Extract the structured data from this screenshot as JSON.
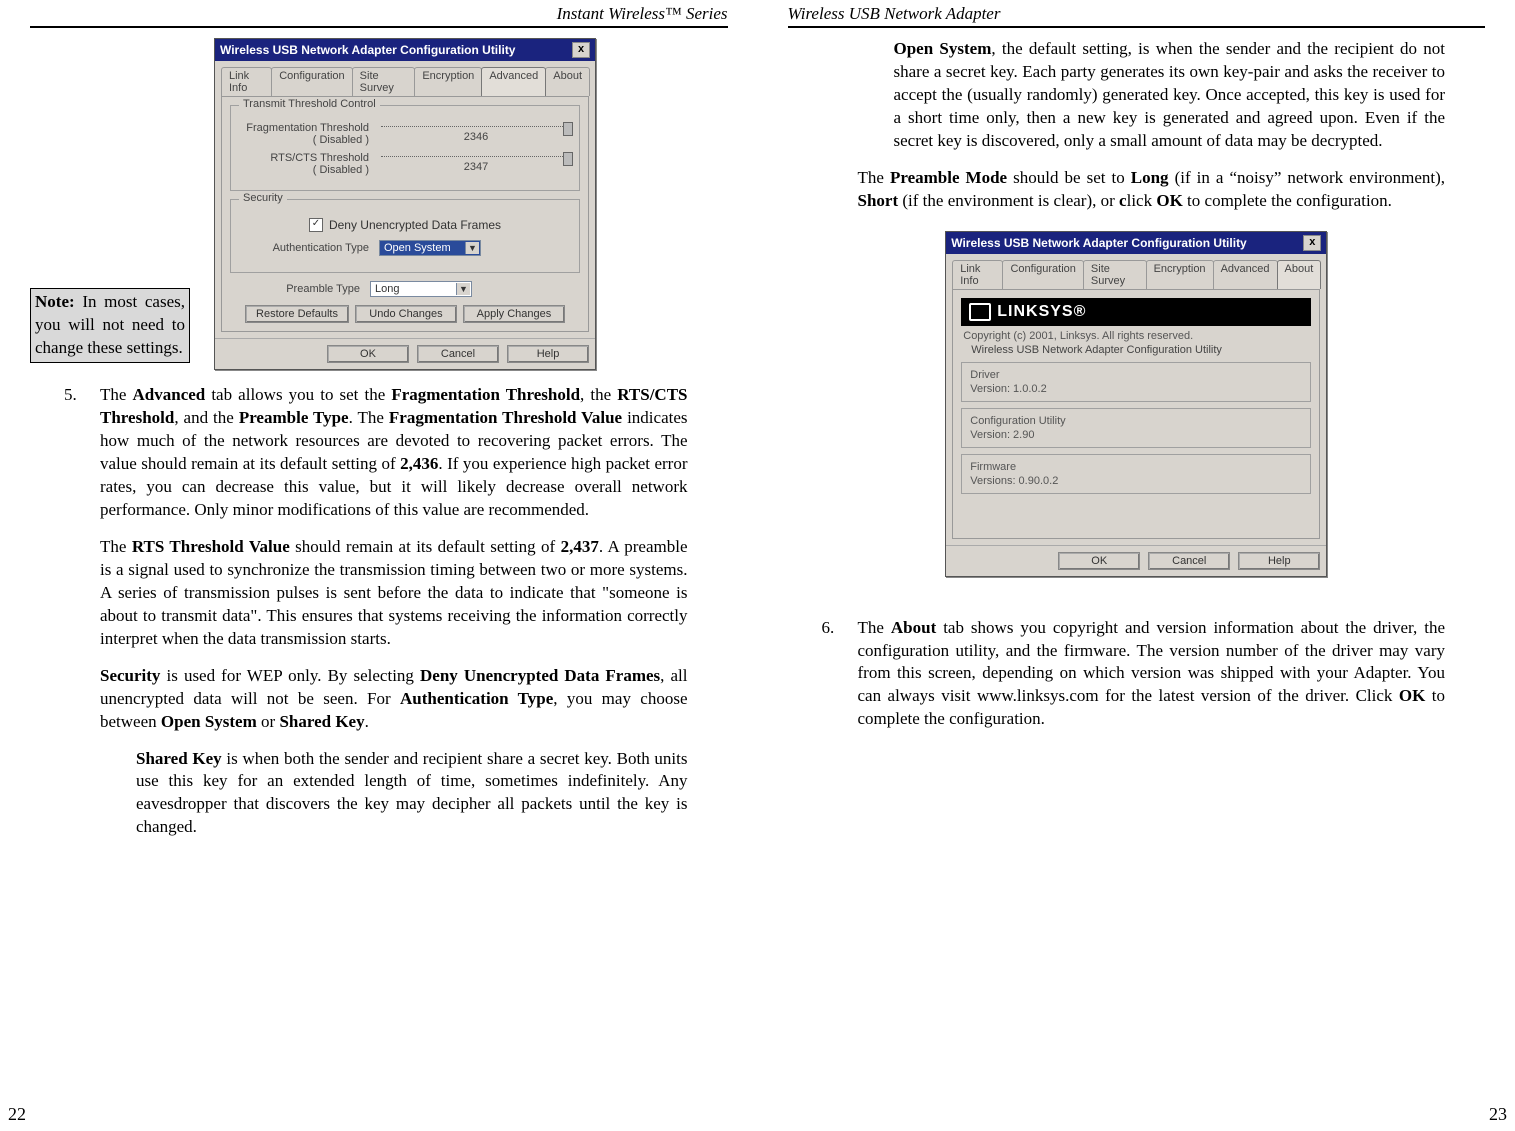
{
  "left": {
    "running_head": "Instant Wireless™ Series",
    "page_number": "22",
    "note": {
      "label": "Note:",
      "text": " In most cases, you will not need to change these settings."
    },
    "dialog1": {
      "title": "Wireless USB Network Adapter Configuration Utility",
      "tabs": [
        "Link Info",
        "Configuration",
        "Site Survey",
        "Encryption",
        "Advanced",
        "About"
      ],
      "active_tab": "Advanced",
      "group_transmit": "Transmit Threshold Control",
      "frag_label": "Fragmentation Threshold\n( Disabled )",
      "frag_value": "2346",
      "rts_label": "RTS/CTS Threshold\n( Disabled )",
      "rts_value": "2347",
      "group_security": "Security",
      "deny_label": "Deny Unencrypted Data Frames",
      "auth_label": "Authentication Type",
      "auth_value": "Open System",
      "preamble_label": "Preamble Type",
      "preamble_value": "Long",
      "btn_restore": "Restore Defaults",
      "btn_undo": "Undo Changes",
      "btn_apply": "Apply Changes",
      "btn_ok": "OK",
      "btn_cancel": "Cancel",
      "btn_help": "Help"
    },
    "item5_num": "5.",
    "p5a_pre": "The ",
    "p5a_b1": "Advanced",
    "p5a_mid1": " tab allows you to set the ",
    "p5a_b2": "Fragmentation Threshold",
    "p5a_mid2": ", the ",
    "p5a_b3": "RTS/CTS Threshold",
    "p5a_mid3": ", and the ",
    "p5a_b4": "Preamble Type",
    "p5a_mid4": ".  The ",
    "p5a_b5": "Fragmentation Threshold Value",
    "p5a_mid5": " indicates how much of the network resources are devoted to recovering packet errors.  The value should remain at its default setting of ",
    "p5a_b6": "2,436",
    "p5a_end": ".  If you experience high packet error rates, you can decrease this value, but it will likely decrease overall network performance.  Only minor modifications of this value are recommended.",
    "p5b_pre": "The ",
    "p5b_b1": "RTS Threshold Value",
    "p5b_mid1": " should remain at its default setting of ",
    "p5b_b2": "2,437",
    "p5b_end": ". A preamble is a signal used to synchronize the transmission timing between two or more systems. A series of transmission pulses is sent  before the data to indicate that \"someone is about to transmit data\". This ensures that systems receiving the information correctly interpret when the data transmission starts.",
    "p5c_b1": "Security",
    "p5c_mid1": " is used for WEP only. By selecting ",
    "p5c_b2": "Deny Unencrypted Data Frames",
    "p5c_mid2": ", all unencrypted data will not be seen.  For ",
    "p5c_b3": "Authentication Type",
    "p5c_mid3": ", you may choose between ",
    "p5c_b4": "Open System",
    "p5c_mid4": " or ",
    "p5c_b5": "Shared Key",
    "p5c_end": ".",
    "p5d_b1": "Shared Key",
    "p5d_end": " is when both the sender and recipient share a secret key. Both units use this key for an extended length of time, sometimes indefinitely. Any eavesdropper that discovers the key may decipher all packets until the key is changed."
  },
  "right": {
    "running_head": "Wireless USB Network Adapter",
    "page_number": "23",
    "p1_b1": "Open System",
    "p1_end": ", the default setting, is when the sender and the recipient do not share a secret key.  Each party generates its own key-pair and asks the receiver to accept the (usually randomly) generated key. Once accepted, this key is used for a short time only, then a new key is generated and agreed upon. Even if the secret key is discovered, only a small amount of data may be decrypted.",
    "p2_pre": "The ",
    "p2_b1": "Preamble Mode",
    "p2_mid1": " should be set to ",
    "p2_b2": "Long",
    "p2_mid2": " (if in a “noisy” network environment), ",
    "p2_b3": "Short",
    "p2_mid3": " (if the environment is clear), or ",
    "p2_c": "c",
    "p2_mid4": "lick ",
    "p2_b4": "OK",
    "p2_end": " to complete the configuration.",
    "dialog2": {
      "title": "Wireless USB Network Adapter Configuration Utility",
      "tabs": [
        "Link Info",
        "Configuration",
        "Site Survey",
        "Encryption",
        "Advanced",
        "About"
      ],
      "active_tab": "About",
      "brand": "LINKSYS®",
      "copyright": "Copyright (c) 2001, Linksys. All rights reserved.",
      "subcaption": "Wireless USB Network Adapter Configuration Utility",
      "driver_title": "Driver",
      "driver_ver": "Version:  1.0.0.2",
      "cfg_title": "Configuration Utility",
      "cfg_ver": "Version:  2.90",
      "fw_title": "Firmware",
      "fw_ver": "Versions: 0.90.0.2",
      "btn_ok": "OK",
      "btn_cancel": "Cancel",
      "btn_help": "Help"
    },
    "item6_num": "6.",
    "p6_pre": "The ",
    "p6_b1": "About",
    "p6_mid1": " tab shows you copyright and version information about the driver, the configuration utility, and the firmware.  The version number of the driver may vary from this screen, depending on which version was shipped with your Adapter.  You can always visit www.linksys.com for the latest version of the driver. Click ",
    "p6_b2": "OK",
    "p6_end": " to complete the configuration."
  }
}
